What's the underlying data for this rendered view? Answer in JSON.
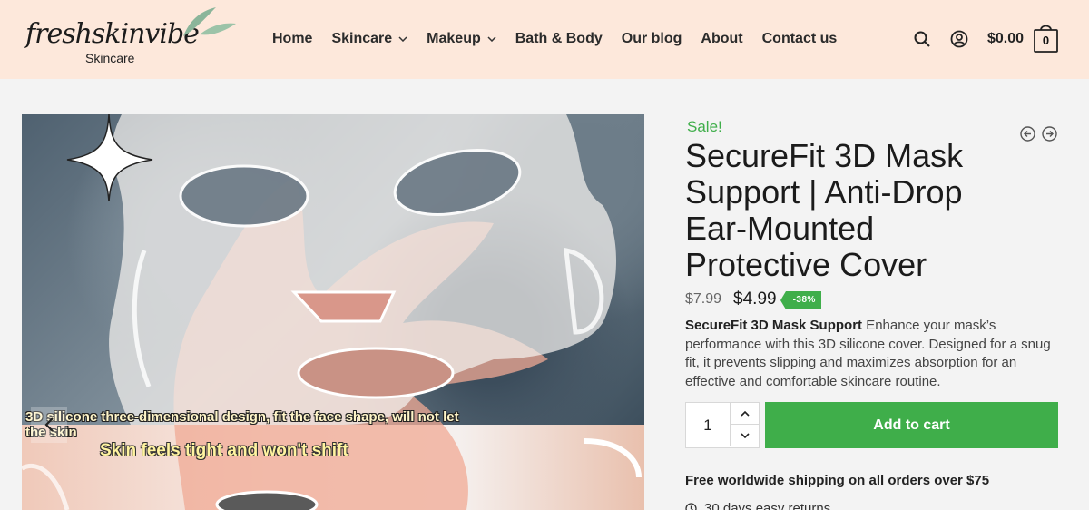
{
  "brand": {
    "name": "freshskinvibe",
    "tagline": "Skincare"
  },
  "nav": {
    "items": [
      {
        "label": "Home",
        "has_dropdown": false
      },
      {
        "label": "Skincare",
        "has_dropdown": true
      },
      {
        "label": "Makeup",
        "has_dropdown": true
      },
      {
        "label": "Bath & Body",
        "has_dropdown": false
      },
      {
        "label": "Our blog",
        "has_dropdown": false
      },
      {
        "label": "About",
        "has_dropdown": false
      },
      {
        "label": "Contact us",
        "has_dropdown": false
      }
    ]
  },
  "header": {
    "cart_total": "$0.00",
    "cart_count": "0"
  },
  "gallery": {
    "caption_1": "3D silicone three-dimensional design, fit the face shape, will not let the skin",
    "caption_2": "Skin feels tight and won't shift"
  },
  "product": {
    "sale_label": "Sale!",
    "title": "SecureFit 3D Mask Support | Anti-Drop Ear-Mounted Protective Cover",
    "price_old": "$7.99",
    "price_new": "$4.99",
    "discount": "-38%",
    "desc_bold": "SecureFit 3D Mask Support",
    "desc_rest": " Enhance your mask’s performance with this 3D silicone cover. Designed for a snug fit, it prevents slipping and maximizes absorption for an effective and comfortable skincare routine.",
    "quantity": "1",
    "add_to_cart": "Add to cart",
    "shipping_note": "Free worldwide shipping on all orders over $75",
    "returns_note": "30 days easy returns"
  },
  "colors": {
    "header_bg": "#fde8db",
    "accent_green": "#3fae4a",
    "page_bg": "#f3f3f3"
  }
}
